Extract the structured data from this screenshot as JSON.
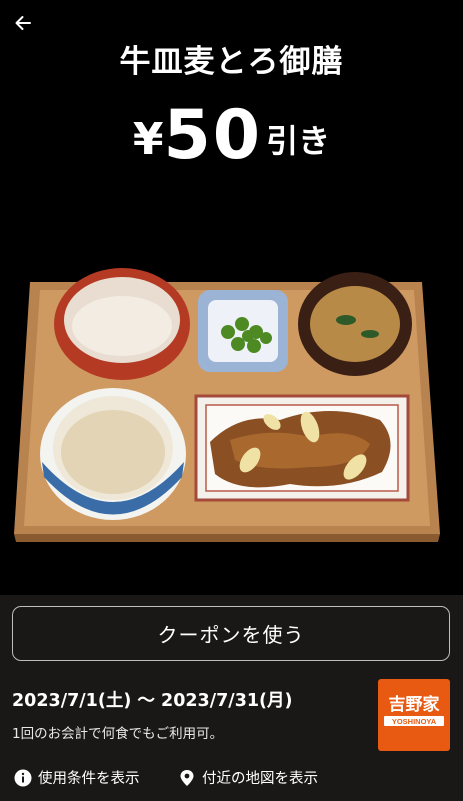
{
  "header": {
    "back_icon": "arrow-left-icon",
    "title": "牛皿麦とろ御膳",
    "price_yen": "¥",
    "price_amount": "50",
    "price_suffix": "引き"
  },
  "coupon": {
    "button_label": "クーポンを使う",
    "date_range": "2023/7/1(土) 〜 2023/7/31(月)",
    "note": "1回のお会計で何食でもご利用可。",
    "logo_text": "吉野家",
    "logo_latin": "YOSHINOYA"
  },
  "links": {
    "terms": "使用条件を表示",
    "terms_icon": "info-icon",
    "map": "付近の地図を表示",
    "map_icon": "location-pin-icon"
  }
}
